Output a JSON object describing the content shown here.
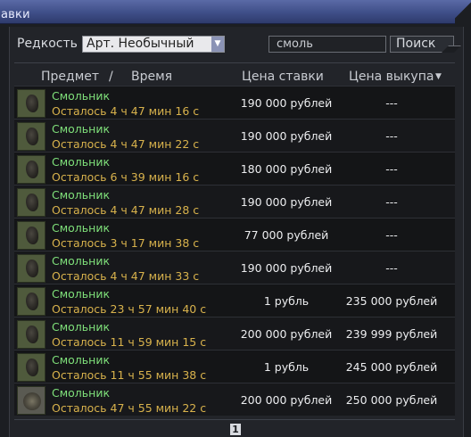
{
  "window": {
    "title": "авки"
  },
  "filters": {
    "rarity_label": "Редкость",
    "rarity_value": "Арт. Необычный",
    "search_value": "смоль",
    "search_button": "Поиск"
  },
  "columns": {
    "item": "Предмет",
    "separator": "/",
    "time": "Время",
    "bid": "Цена ставки",
    "buyout": "Цена выкупа",
    "sort_icon": "▼"
  },
  "rows": [
    {
      "name": "Смольник",
      "time": "Осталось 4 ч 47 мин 16 с",
      "bid": "190 000 рублей",
      "buyout": "---",
      "icon": "resin-artifact-icon"
    },
    {
      "name": "Смольник",
      "time": "Осталось 4 ч 47 мин 22 с",
      "bid": "190 000 рублей",
      "buyout": "---",
      "icon": "resin-artifact-icon"
    },
    {
      "name": "Смольник",
      "time": "Осталось 6 ч 39 мин 16 с",
      "bid": "180 000 рублей",
      "buyout": "---",
      "icon": "resin-artifact-icon"
    },
    {
      "name": "Смольник",
      "time": "Осталось 4 ч 47 мин 28 с",
      "bid": "190 000 рублей",
      "buyout": "---",
      "icon": "resin-artifact-icon"
    },
    {
      "name": "Смольник",
      "time": "Осталось 3 ч 17 мин 38 с",
      "bid": "77 000 рублей",
      "buyout": "---",
      "icon": "resin-artifact-icon"
    },
    {
      "name": "Смольник",
      "time": "Осталось 4 ч 47 мин 33 с",
      "bid": "190 000 рублей",
      "buyout": "---",
      "icon": "resin-artifact-icon"
    },
    {
      "name": "Смольник",
      "time": "Осталось 23 ч 57 мин 40 с",
      "bid": "1 рубль",
      "buyout": "235 000 рублей",
      "icon": "resin-artifact-icon"
    },
    {
      "name": "Смольник",
      "time": "Осталось 11 ч 59 мин 15 с",
      "bid": "200 000 рублей",
      "buyout": "239 999 рублей",
      "icon": "resin-artifact-icon"
    },
    {
      "name": "Смольник",
      "time": "Осталось 11 ч 55 мин 38 с",
      "bid": "1 рубль",
      "buyout": "245 000 рублей",
      "icon": "resin-artifact-icon"
    },
    {
      "name": "Смольник",
      "time": "Осталось 47 ч 55 мин 22 с",
      "bid": "200 000 рублей",
      "buyout": "250 000 рублей",
      "icon": "resin-artifact-icon-alt"
    }
  ],
  "pagination": {
    "current_page": "1"
  }
}
